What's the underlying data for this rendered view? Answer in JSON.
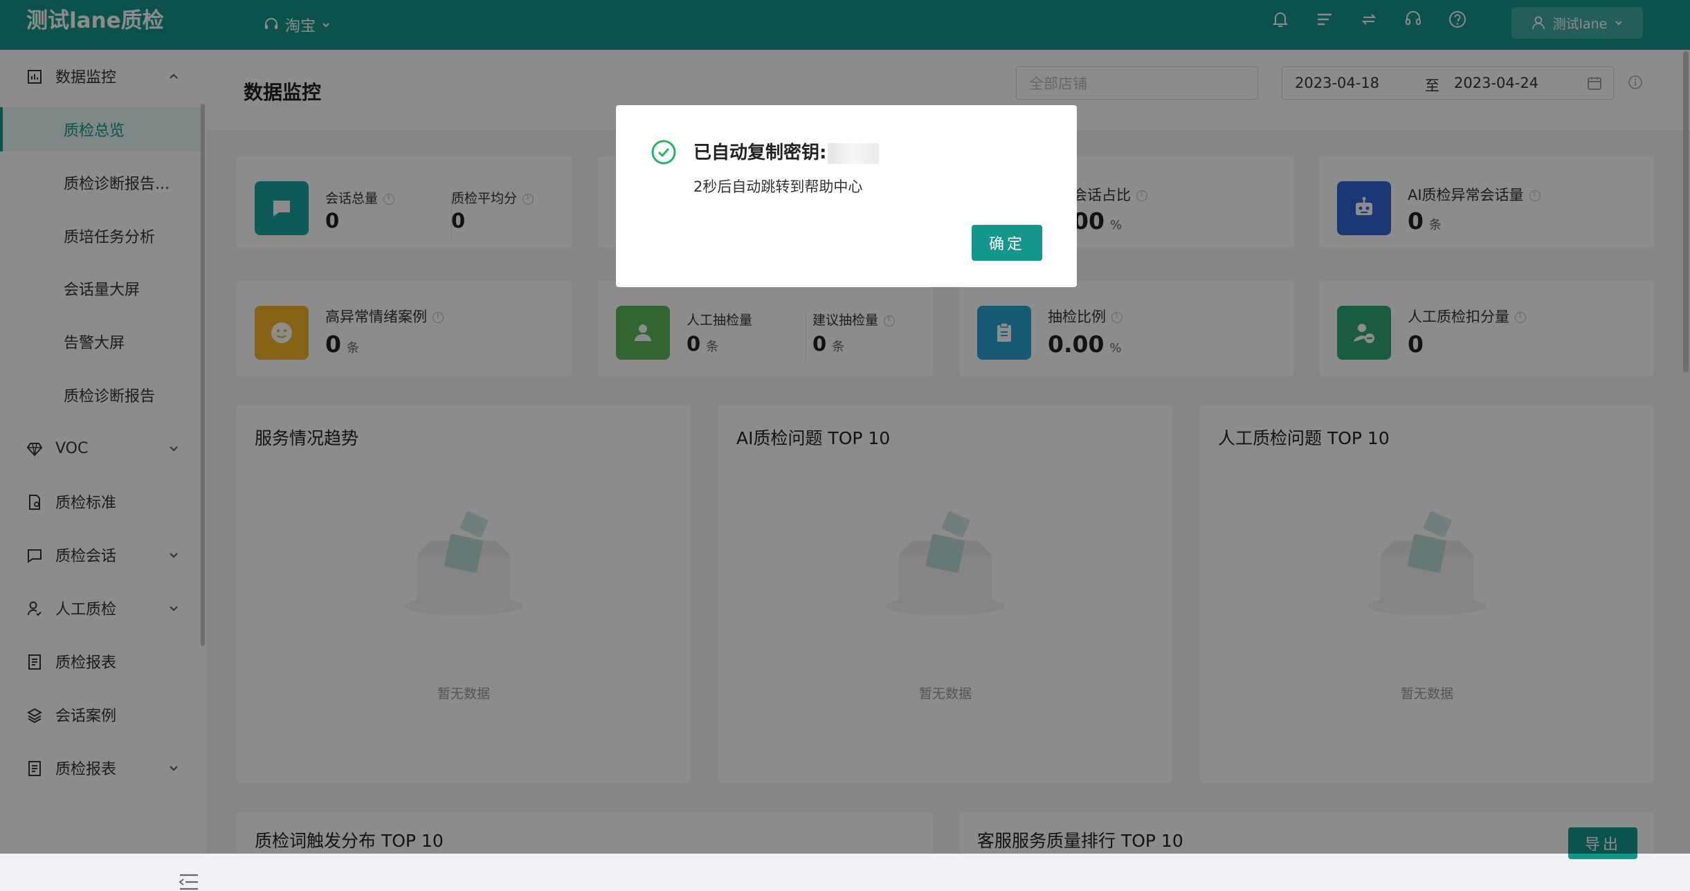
{
  "app": {
    "title": "测试lane质检",
    "platform": "淘宝",
    "user": "测试lane"
  },
  "header_icons": [
    "bell-icon",
    "list-icon",
    "switch-icon",
    "headset-icon",
    "help-icon"
  ],
  "sidebar": {
    "groups": [
      {
        "label": "数据监控",
        "icon": "bar-chart-icon",
        "expanded": true,
        "children": [
          "质检总览",
          "质检诊断报告...",
          "质培任务分析",
          "会话量大屏",
          "告警大屏",
          "质检诊断报告"
        ],
        "active": "质检总览"
      },
      {
        "label": "VOC",
        "icon": "diamond-icon",
        "expandable": true
      },
      {
        "label": "质检标准",
        "icon": "document-icon",
        "expandable": false
      },
      {
        "label": "质检会话",
        "icon": "chat-icon",
        "expandable": true
      },
      {
        "label": "人工质检",
        "icon": "user-check-icon",
        "expandable": true
      },
      {
        "label": "质检报表",
        "icon": "report-icon",
        "expandable": false
      },
      {
        "label": "会话案例",
        "icon": "layers-icon",
        "expandable": false
      },
      {
        "label": "质检报表",
        "icon": "report-icon",
        "expandable": true
      }
    ]
  },
  "page": {
    "title": "数据监控",
    "store_placeholder": "全部店铺",
    "date_start": "2023-04-18",
    "date_sep": "至",
    "date_end": "2023-04-24"
  },
  "stats": {
    "row1": [
      {
        "label1": "会话总量",
        "value1": "0",
        "label2": "质检平均分",
        "value2": "0",
        "color": "#1aa3a3"
      },
      {
        "label": "会话占比",
        "value": "00",
        "unit": "%"
      },
      {
        "label": "AI质检异常会话量",
        "value": "0",
        "unit": "条",
        "color": "#2f63d6"
      }
    ],
    "row2": [
      {
        "label": "高异常情绪案例",
        "value": "0",
        "unit": "条",
        "color": "#f0b429"
      },
      {
        "label1": "人工抽检量",
        "value1": "0",
        "unit1": "条",
        "label2": "建议抽检量",
        "value2": "0",
        "unit2": "条",
        "color": "#5cb85c"
      },
      {
        "label": "抽检比例",
        "value": "0.00",
        "unit": "%",
        "color": "#2aa3cf"
      },
      {
        "label": "人工质检扣分量",
        "value": "0",
        "color": "#2fa876"
      }
    ]
  },
  "panels": [
    {
      "title": "服务情况趋势",
      "empty": "暂无数据"
    },
    {
      "title": "AI质检问题 TOP 10",
      "empty": "暂无数据"
    },
    {
      "title": "人工质检问题 TOP 10",
      "empty": "暂无数据"
    }
  ],
  "bottom_panels": [
    {
      "title": "质检词触发分布 TOP 10"
    },
    {
      "title": "客服服务质量排行 TOP 10",
      "button": "导出"
    }
  ],
  "modal": {
    "title": "已自动复制密钥:",
    "message": "2秒后自动跳转到帮助中心",
    "confirm": "确定"
  }
}
